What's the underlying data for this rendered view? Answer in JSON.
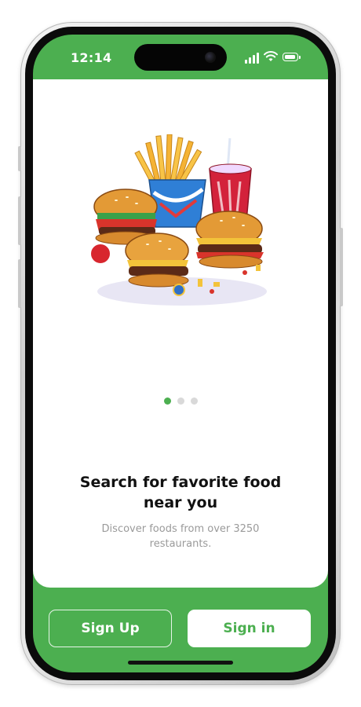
{
  "status_bar": {
    "time": "12:14"
  },
  "onboarding": {
    "title": "Search for favorite food near you",
    "subtitle": "Discover foods from over 3250 restaurants.",
    "page_indicator": {
      "total": 3,
      "active": 1
    }
  },
  "actions": {
    "sign_up": "Sign Up",
    "sign_in": "Sign in"
  },
  "colors": {
    "accent": "#4CAF50",
    "title": "#111111",
    "subtitle": "#9A9A9A"
  }
}
